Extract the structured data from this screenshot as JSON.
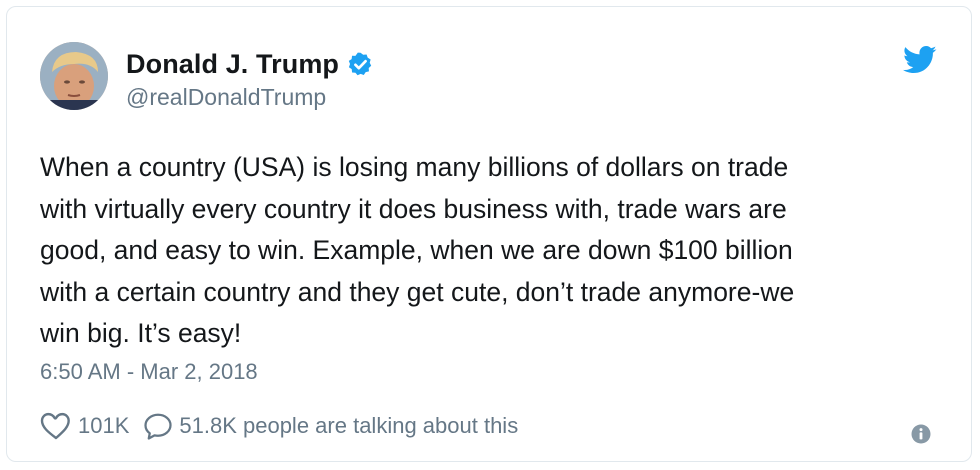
{
  "tweet": {
    "display_name": "Donald J. Trump",
    "handle": "@realDonaldTrump",
    "text": "When a country (USA) is losing many billions of dollars on trade\nwith virtually every country it does business with, trade wars are\ngood, and easy to win. Example, when we are down $100 billion\nwith a certain country and they get cute, don’t trade anymore-we\nwin big. It’s easy!",
    "timestamp": "6:50 AM - Mar 2, 2018",
    "likes": "101K",
    "talking": "51.8K people are talking about this",
    "verified": true
  },
  "icons": {
    "verified": "verified-badge-icon",
    "bird": "twitter-bird-icon",
    "like": "heart-icon",
    "reply": "speech-bubble-icon",
    "info": "info-icon"
  },
  "colors": {
    "brand_blue": "#1da1f2",
    "text_primary": "#14171a",
    "text_secondary": "#657786",
    "border": "#e1e8ed"
  }
}
